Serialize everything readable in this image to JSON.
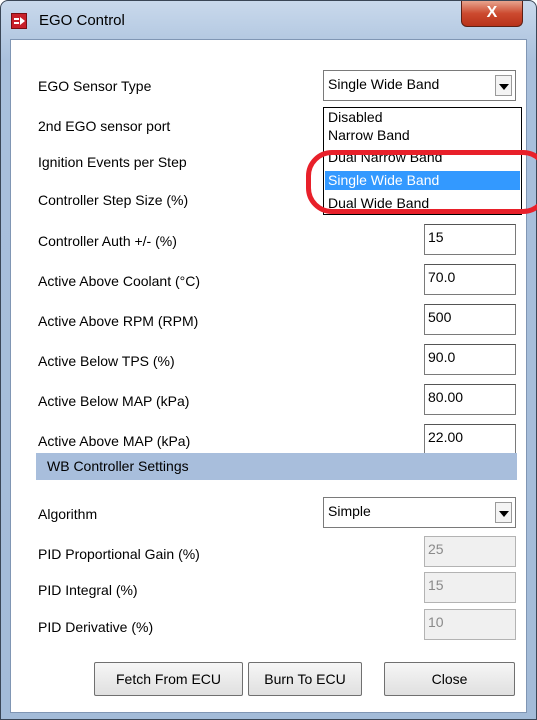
{
  "window": {
    "title": "EGO Control",
    "close_glyph": "X"
  },
  "fields": {
    "ego_sensor_type": {
      "label": "EGO Sensor Type",
      "value": "Single Wide Band"
    },
    "second_ego_port": {
      "label": "2nd EGO sensor port"
    },
    "ignition_events": {
      "label": "Ignition Events per Step"
    },
    "controller_step_size": {
      "label": "Controller Step Size (%)"
    },
    "controller_auth": {
      "label": "Controller Auth +/- (%)",
      "value": "15"
    },
    "active_above_coolant": {
      "label": "Active Above Coolant (°C)",
      "value": "70.0"
    },
    "active_above_rpm": {
      "label": "Active Above RPM (RPM)",
      "value": "500"
    },
    "active_below_tps": {
      "label": "Active Below TPS (%)",
      "value": "90.0"
    },
    "active_below_map": {
      "label": "Active Below MAP (kPa)",
      "value": "80.00"
    },
    "active_above_map": {
      "label": "Active Above MAP (kPa)",
      "value": "22.00"
    }
  },
  "dropdown_options": [
    {
      "label": "Disabled",
      "selected": false
    },
    {
      "label": "Narrow Band",
      "selected": false
    },
    {
      "label": "Dual Narrow Band",
      "selected": false
    },
    {
      "label": "Single Wide Band",
      "selected": true
    },
    {
      "label": "Dual Wide Band",
      "selected": false
    }
  ],
  "wb_section": {
    "title": "WB Controller Settings",
    "algorithm": {
      "label": "Algorithm",
      "value": "Simple"
    },
    "pid_proportional": {
      "label": "PID Proportional Gain (%)",
      "value": "25"
    },
    "pid_integral": {
      "label": "PID Integral (%)",
      "value": "15"
    },
    "pid_derivative": {
      "label": "PID Derivative (%)",
      "value": "10"
    }
  },
  "buttons": {
    "fetch": "Fetch From ECU",
    "burn": "Burn To ECU",
    "close": "Close"
  },
  "colors": {
    "highlight": "#3399ff",
    "annotation": "#e8202a",
    "section_bg": "#a8bedc"
  }
}
